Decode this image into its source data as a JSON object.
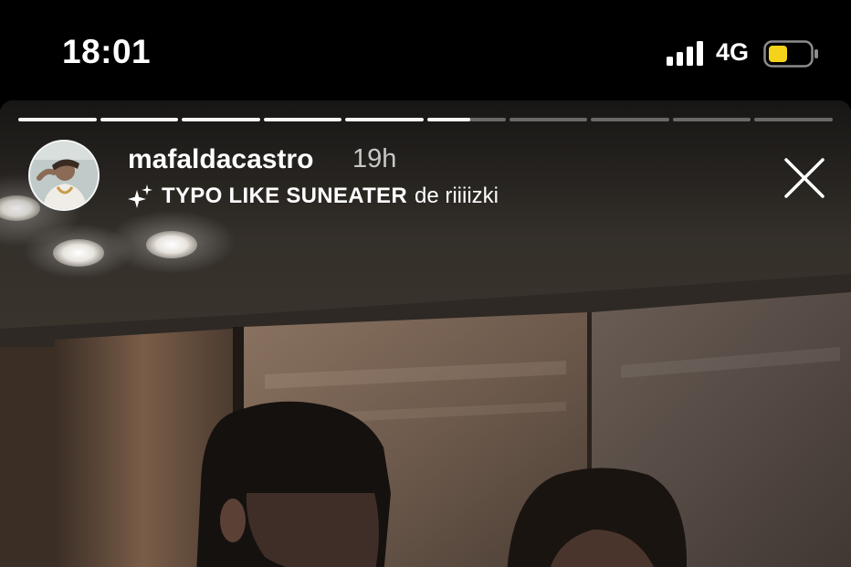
{
  "status_bar": {
    "time": "18:01",
    "network": "4G",
    "battery_color": "#f5d31b",
    "icons": [
      "signal-icon",
      "battery-icon"
    ]
  },
  "story": {
    "segments_total": 10,
    "segments_completed": 5,
    "current_segment_progress": 0.55,
    "username": "mafaldacastro",
    "timestamp": "19h",
    "music": {
      "icon": "sparkle-icon",
      "title": "TYPO LIKE SUNEATER",
      "by": "de riiiizki"
    },
    "close_icon": "close-icon"
  }
}
